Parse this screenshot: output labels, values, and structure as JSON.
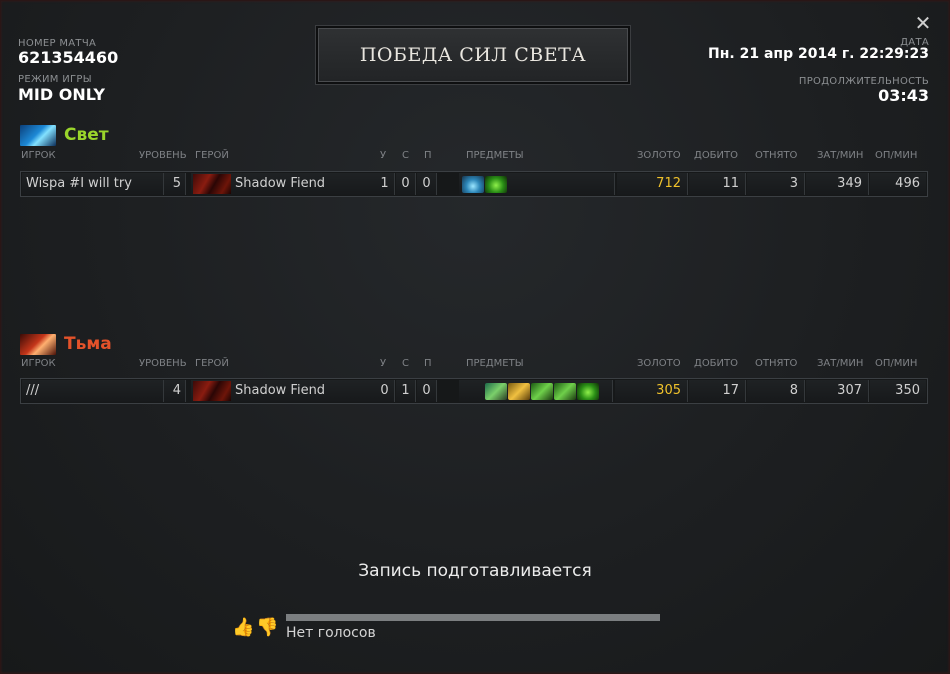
{
  "header": {
    "match_id_label": "НОМЕР МАТЧА",
    "match_id": "621354460",
    "mode_label": "РЕЖИМ ИГРЫ",
    "mode": "MID ONLY",
    "date_label": "ДАТА",
    "date": "Пн. 21 апр 2014 г. 22:29:23",
    "duration_label": "ПРОДОЛЖИТЕЛЬНОСТЬ",
    "duration": "03:43",
    "result": "ПОБЕДА СИЛ СВЕТА",
    "close_icon": "✕"
  },
  "columns": {
    "player": "ИГРОК",
    "level": "УРОВЕНЬ",
    "hero": "ГЕРОЙ",
    "kills": "У",
    "deaths": "С",
    "assists": "П",
    "items": "ПРЕДМЕТЫ",
    "gold": "ЗОЛОТО",
    "last_hits": "ДОБИТО",
    "denies": "ОТНЯТО",
    "xpm": "ЗАТ/МИН",
    "gpm": "ОП/МИН"
  },
  "teams": {
    "radiant": {
      "name": "Свет",
      "color": "#9ad52b",
      "players": [
        {
          "player": "Wispa #I will try",
          "level": "5",
          "hero": "Shadow Fiend",
          "kills": "1",
          "deaths": "0",
          "assists": "0",
          "items": [
            "bottle-icon",
            "tango-icon"
          ],
          "gold": "712",
          "last_hits": "11",
          "denies": "3",
          "xpm": "349",
          "gpm": "496"
        }
      ]
    },
    "dire": {
      "name": "Тьма",
      "color": "#e3522a",
      "players": [
        {
          "player": "///",
          "level": "4",
          "hero": "Shadow Fiend",
          "kills": "0",
          "deaths": "1",
          "assists": "0",
          "items": [
            "boots-icon",
            "blades-icon",
            "circlet-icon",
            "circlet-icon",
            "tango-icon"
          ],
          "gold": "305",
          "last_hits": "17",
          "denies": "8",
          "xpm": "307",
          "gpm": "350"
        }
      ]
    }
  },
  "footer": {
    "replay_status": "Запись подготавливается",
    "votes": "Нет голосов",
    "thumb_up_icon": "👍",
    "thumb_down_icon": "👎",
    "gold_color": "#f0c22b"
  }
}
